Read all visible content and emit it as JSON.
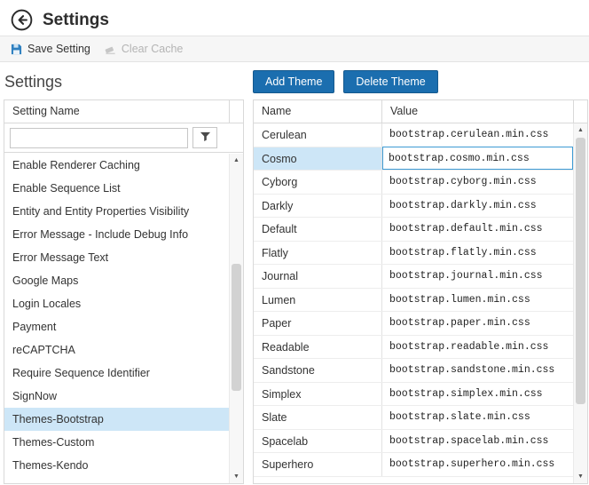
{
  "header": {
    "title": "Settings"
  },
  "toolbar": {
    "save_label": "Save Setting",
    "clear_label": "Clear Cache"
  },
  "left_panel": {
    "heading": "Settings",
    "column_header": "Setting Name",
    "filter": {
      "value": "",
      "placeholder": ""
    },
    "items": [
      {
        "label": "Enable Renderer Caching",
        "selected": false
      },
      {
        "label": "Enable Sequence List",
        "selected": false
      },
      {
        "label": "Entity and Entity Properties Visibility",
        "selected": false
      },
      {
        "label": "Error Message - Include Debug Info",
        "selected": false
      },
      {
        "label": "Error Message Text",
        "selected": false
      },
      {
        "label": "Google Maps",
        "selected": false
      },
      {
        "label": "Login Locales",
        "selected": false
      },
      {
        "label": "Payment",
        "selected": false
      },
      {
        "label": "reCAPTCHA",
        "selected": false
      },
      {
        "label": "Require Sequence Identifier",
        "selected": false
      },
      {
        "label": "SignNow",
        "selected": false
      },
      {
        "label": "Themes-Bootstrap",
        "selected": true
      },
      {
        "label": "Themes-Custom",
        "selected": false
      },
      {
        "label": "Themes-Kendo",
        "selected": false
      }
    ]
  },
  "right_panel": {
    "add_button": "Add Theme",
    "delete_button": "Delete Theme",
    "columns": [
      "Name",
      "Value"
    ],
    "rows": [
      {
        "name": "Cerulean",
        "value": "bootstrap.cerulean.min.css",
        "editing": false
      },
      {
        "name": "Cosmo",
        "value": "bootstrap.cosmo.min.css",
        "editing": true
      },
      {
        "name": "Cyborg",
        "value": "bootstrap.cyborg.min.css",
        "editing": false
      },
      {
        "name": "Darkly",
        "value": "bootstrap.darkly.min.css",
        "editing": false
      },
      {
        "name": "Default",
        "value": "bootstrap.default.min.css",
        "editing": false
      },
      {
        "name": "Flatly",
        "value": "bootstrap.flatly.min.css",
        "editing": false
      },
      {
        "name": "Journal",
        "value": "bootstrap.journal.min.css",
        "editing": false
      },
      {
        "name": "Lumen",
        "value": "bootstrap.lumen.min.css",
        "editing": false
      },
      {
        "name": "Paper",
        "value": "bootstrap.paper.min.css",
        "editing": false
      },
      {
        "name": "Readable",
        "value": "bootstrap.readable.min.css",
        "editing": false
      },
      {
        "name": "Sandstone",
        "value": "bootstrap.sandstone.min.css",
        "editing": false
      },
      {
        "name": "Simplex",
        "value": "bootstrap.simplex.min.css",
        "editing": false
      },
      {
        "name": "Slate",
        "value": "bootstrap.slate.min.css",
        "editing": false
      },
      {
        "name": "Spacelab",
        "value": "bootstrap.spacelab.min.css",
        "editing": false
      },
      {
        "name": "Superhero",
        "value": "bootstrap.superhero.min.css",
        "editing": false
      }
    ]
  },
  "icons": {
    "back": "arrow-left-circle",
    "save": "save-disk",
    "clear_cache": "eraser",
    "filter": "funnel"
  },
  "glyphs": {
    "up": "▲",
    "down": "▼"
  },
  "colors": {
    "accent": "#1b6eaf",
    "selected_row": "#cde6f7",
    "edit_border": "#3d9bd4",
    "disabled_text": "#b4b4b4"
  }
}
